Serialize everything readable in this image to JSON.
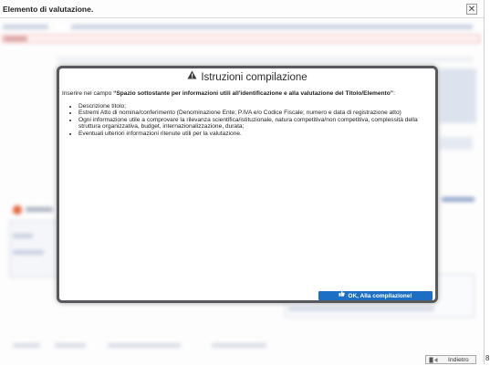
{
  "window": {
    "title": "Elemento di valutazione.",
    "close_glyph": "✕"
  },
  "popup": {
    "title": "Istruzioni compilazione",
    "intro_prefix": "Inserire nel campo ",
    "intro_field": "“Spazio sottostante per informazioni utili all'identificazione e alla valutazione del Titolo/Elemento”",
    "intro_suffix": ":",
    "items": [
      "Descrizione titolo;",
      "Estremi Atto di nomina/conferimento (Denominazione Ente; P.IVA e/o Codice Fiscale; numero e data di registrazione atto)",
      "Ogni informazione utile a comprovare la rilevanza scientifica/istituzionale, natura competitiva/non competitiva, complessità della struttura organizzativa, budget, internazionalizzazione, durata;",
      "Eventuali ulteriori informazioni ritenute utili per la valutazione."
    ],
    "ok_label": "OK, Alla compilazione!"
  },
  "footer": {
    "back_label": "Indietro",
    "edge_glyph": "8"
  },
  "colors": {
    "ok_button": "#1d6fc5",
    "popup_border": "#58595d",
    "warning": "#2b2b2b"
  }
}
